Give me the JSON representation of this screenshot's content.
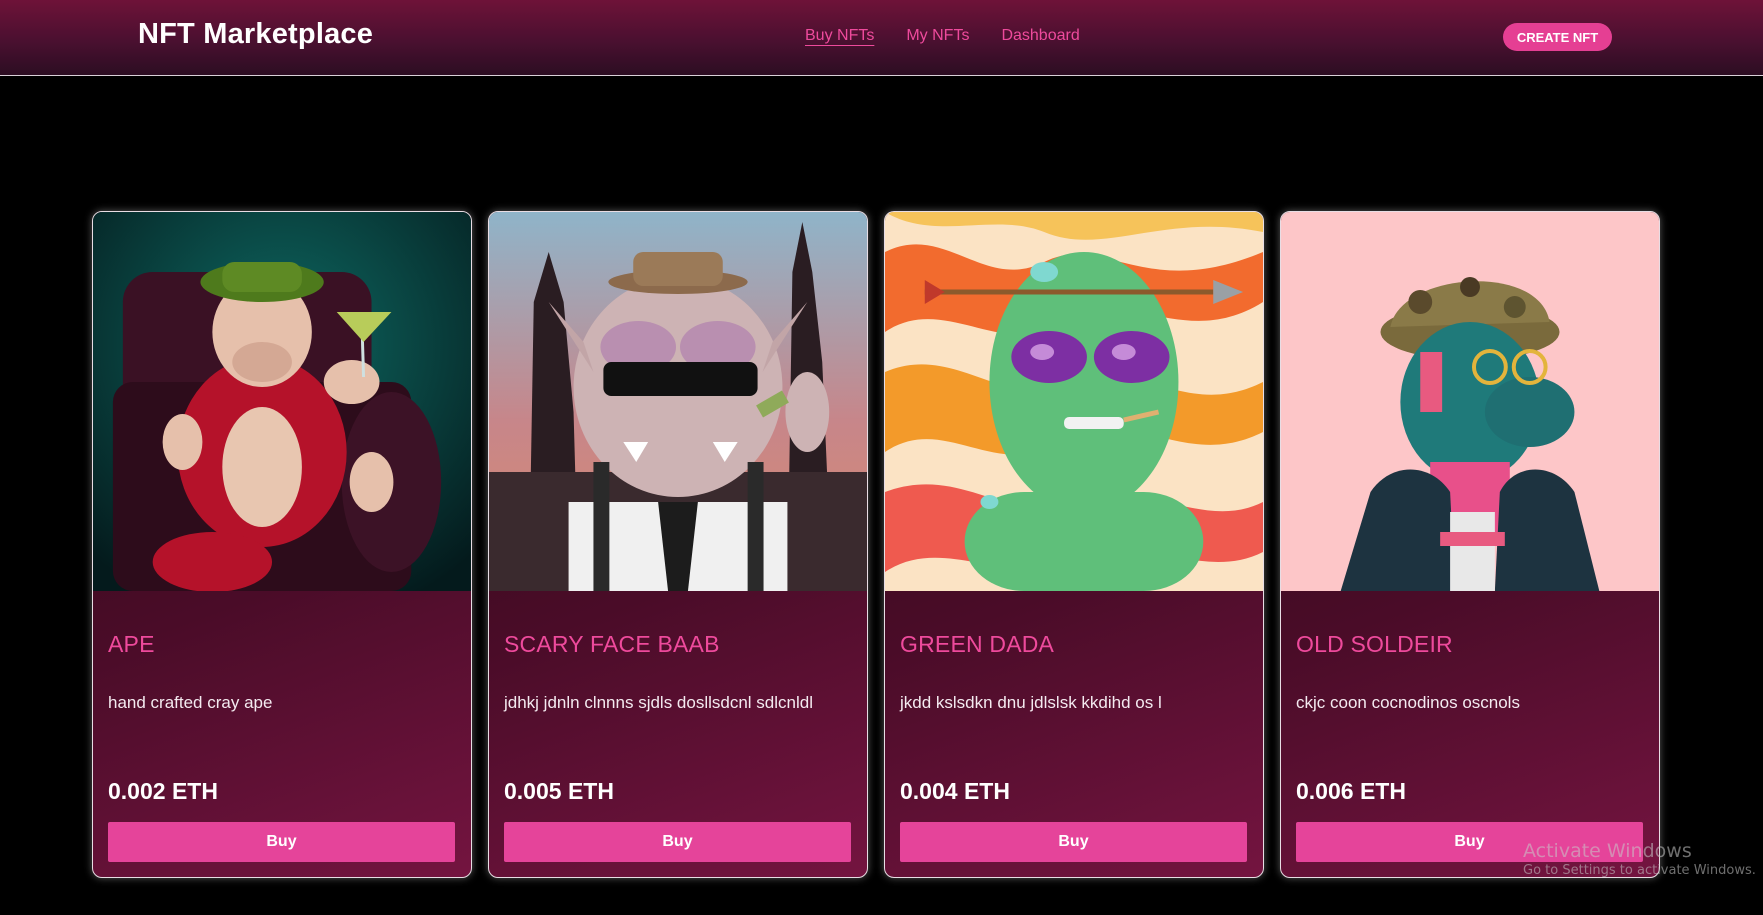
{
  "navbar": {
    "brand": "NFT Marketplace",
    "links": [
      "Buy NFTs",
      "My NFTs",
      "Dashboard"
    ],
    "active_link": "Buy NFTs",
    "create_button": "CREATE NFT"
  },
  "cards": [
    {
      "title": "APE",
      "description": "hand crafted cray ape",
      "price": "0.002 ETH",
      "buy_label": "Buy",
      "image": "ape-nft-image"
    },
    {
      "title": "SCARY FACE BAAB",
      "description": "jdhkj jdnln clnnns sjdls dosllsdcnl sdlcnldl",
      "price": "0.005 ETH",
      "buy_label": "Buy",
      "image": "scary-face-nft-image"
    },
    {
      "title": "GREEN DADA",
      "description": "jkdd kslsdkn dnu jdlslsk kkdihd os l",
      "price": "0.004 ETH",
      "buy_label": "Buy",
      "image": "green-alien-nft-image"
    },
    {
      "title": "OLD SOLDEIR",
      "description": "ckjc coon cocnodinos oscnols",
      "price": "0.006 ETH",
      "buy_label": "Buy",
      "image": "old-soldier-nft-image"
    }
  ],
  "colors": {
    "accent": "#e5449a",
    "link": "#ee4a9c",
    "background": "#000000"
  },
  "watermark": {
    "title": "Activate Windows",
    "subtitle": "Go to Settings to activate Windows."
  }
}
